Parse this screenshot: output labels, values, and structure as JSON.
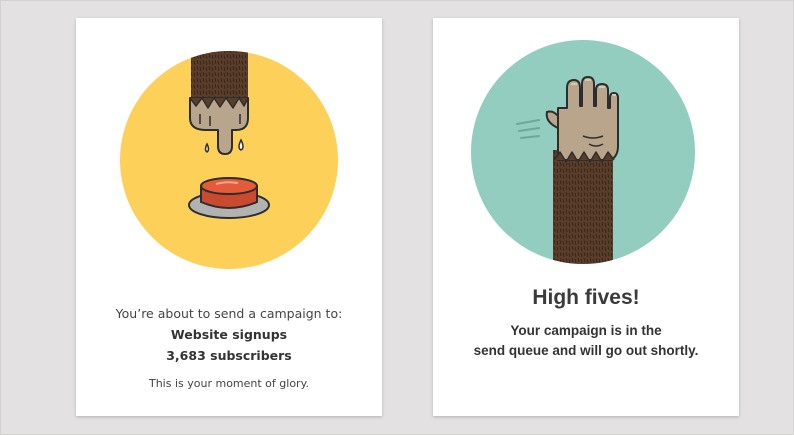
{
  "colors": {
    "page_background": "#e3e1e1",
    "card_background": "#ffffff",
    "circle_yellow": "#fdd05a",
    "circle_teal": "#93cdc0",
    "fur_brown": "#5a3e2b",
    "skin_tan": "#b8a58c",
    "button_red": "#e35b3a",
    "plate_gray": "#b2b2b2",
    "text_dark": "#3a3a3a"
  },
  "confirm_card": {
    "illustration_icon": "finger-pressing-red-button-icon",
    "intro": "You’re about to send a campaign to:",
    "list_name": "Website signups",
    "subscriber_count": "3,683 subscribers",
    "tagline": "This is your moment of glory."
  },
  "success_card": {
    "illustration_icon": "raised-hand-high-five-icon",
    "title": "High fives!",
    "message_line_1": "Your campaign is in the",
    "message_line_2": "send queue and will go out shortly."
  }
}
